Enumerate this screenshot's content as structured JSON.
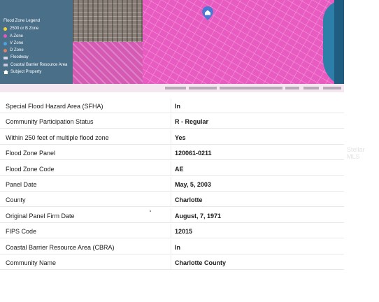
{
  "map": {
    "legend": {
      "title": "Flood Zone Legend",
      "items": [
        {
          "label": "2500 or B Zone",
          "icon": "yellow-dot-icon",
          "color": "#f2d13c"
        },
        {
          "label": "A Zone",
          "icon": "pink-dot-icon",
          "color": "#e655c0"
        },
        {
          "label": "V Zone",
          "icon": "blue-dot-icon",
          "color": "#4fa3e0"
        },
        {
          "label": "D Zone",
          "icon": "orange-dot-icon",
          "color": "#d9826a"
        },
        {
          "label": "Floodway",
          "icon": "floodway-swatch-icon",
          "color": "#d6d6e6"
        },
        {
          "label": "Coastal Barrier Resource Area",
          "icon": "cbra-swatch-icon",
          "color": "#c9c9d9"
        },
        {
          "label": "Subject Property",
          "icon": "house-icon",
          "color": "#ffffff"
        }
      ]
    },
    "colors": {
      "zone_a": "#e85bc0",
      "legend_bg": "#4a6f88",
      "water": "#2c7fa8",
      "pin": "#4a78d4"
    }
  },
  "table": {
    "rows": [
      {
        "label": "Special Flood Hazard Area (SFHA)",
        "value": "In"
      },
      {
        "label": "Community Participation Status",
        "value": "R - Regular"
      },
      {
        "label": "Within 250 feet of multiple flood zone",
        "value": "Yes"
      },
      {
        "label": "Flood Zone Panel",
        "value": "120061-0211"
      },
      {
        "label": "Flood Zone Code",
        "value": "AE"
      },
      {
        "label": "Panel Date",
        "value": "May, 5, 2003"
      },
      {
        "label": "County",
        "value": "Charlotte"
      },
      {
        "label": "Original Panel Firm Date",
        "value": "August, 7, 1971"
      },
      {
        "label": "FIPS Code",
        "value": "12015"
      },
      {
        "label": "Coastal Barrier Resource Area (CBRA)",
        "value": "In"
      },
      {
        "label": "Community Name",
        "value": "Charlotte County"
      }
    ]
  },
  "watermark": "Stellar MLS"
}
